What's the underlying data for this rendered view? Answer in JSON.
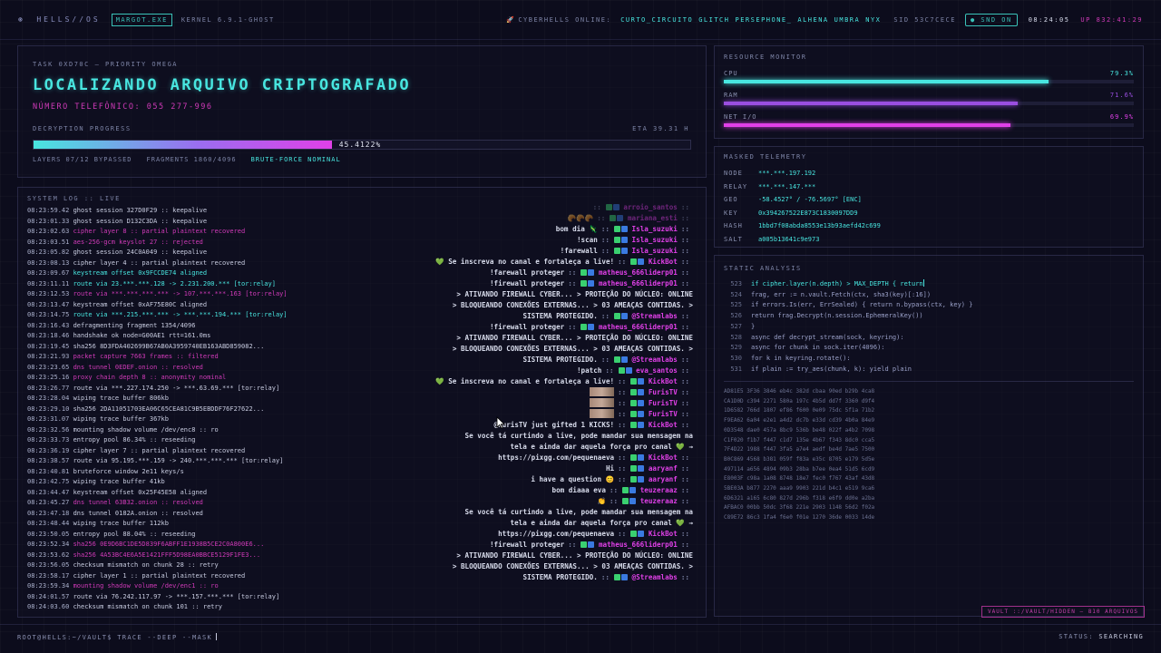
{
  "topbar": {
    "brand": "HELLS//OS",
    "exe": "MARGOT.EXE",
    "kernel": "KERNEL 6.9.1-GHOST",
    "online_label": "CYBERHELLS ONLINE:",
    "users": [
      "CURTO_CIRCUITO",
      "GLITCH",
      "PERSEPHONE_",
      "ALHENA",
      "UMBRA",
      "NYX"
    ],
    "sid": "SID 53C7CECE",
    "snd": "SND ON",
    "clock": "08:24:05",
    "uptime": "UP 832:41:29"
  },
  "task": {
    "label": "TASK 0XD70C — PRIORITY OMEGA",
    "headline": "LOCALIZANDO ARQUIVO CRIPTOGRAFADO",
    "phone": "NÚMERO TELEFÔNICO: 055 277-996",
    "progress_label": "DECRYPTION PROGRESS",
    "eta": "ETA 39.31 H",
    "progress_value": 45.4122,
    "progress_text": "45.4122%",
    "layers": "LAYERS 07/12 BYPASSED",
    "fragments": "FRAGMENTS 1860/4096",
    "mode": "BRUTE-FORCE NOMINAL"
  },
  "log": {
    "title": "SYSTEM LOG :: LIVE",
    "entries": [
      {
        "t": "08:23:59.42",
        "m": "ghost session 327D0F29 :: keepalive",
        "c": "plain"
      },
      {
        "t": "08:23:01.33",
        "m": "ghost session D132C3DA :: keepalive",
        "c": "plain"
      },
      {
        "t": "08:23:02.63",
        "m": "cipher layer 8 :: partial plaintext recovered",
        "c": "mag"
      },
      {
        "t": "08:23:03.51",
        "m": "aes-256-gcm keyslot 27 :: rejected",
        "c": "mag"
      },
      {
        "t": "08:23:05.82",
        "m": "ghost session 24C0A049 :: keepalive",
        "c": "plain"
      },
      {
        "t": "08:23:08.13",
        "m": "cipher layer 4 :: partial plaintext recovered",
        "c": "plain"
      },
      {
        "t": "08:23:09.67",
        "m": "keystream offset 0x9FCCDE74 aligned",
        "c": "cyan"
      },
      {
        "t": "08:23:11.11",
        "m": "route via 23.***.***.128 -> 2.231.200.*** [tor:relay]",
        "c": "cyan"
      },
      {
        "t": "08:23:12.53",
        "m": "route via ***.***.***.*** -> 107.***.***.163 [tor:relay]",
        "c": "mag"
      },
      {
        "t": "08:23:13.47",
        "m": "keystream offset 0xAF75E80C aligned",
        "c": "plain"
      },
      {
        "t": "08:23:14.75",
        "m": "route via ***.215.***.*** -> ***.***.194.*** [tor:relay]",
        "c": "cyan"
      },
      {
        "t": "08:23:16.43",
        "m": "defragmenting fragment 1354/4096",
        "c": "plain"
      },
      {
        "t": "08:23:18.46",
        "m": "handshake ok node=G00AE1 rtt=161.0ms",
        "c": "plain"
      },
      {
        "t": "08:23:19.45",
        "m": "sha256 8D3FDA402699B67AB0A3959740EB163ABD859082...",
        "c": "plain"
      },
      {
        "t": "08:23:21.93",
        "m": "packet capture 7663 frames :: filtered",
        "c": "mag"
      },
      {
        "t": "08:23:23.65",
        "m": "dns tunnel 0EDEF.onion :: resolved",
        "c": "mag"
      },
      {
        "t": "08:23:25.16",
        "m": "proxy chain depth 8 :: anonymity nominal",
        "c": "mag"
      },
      {
        "t": "08:23:26.77",
        "m": "route via ***.227.174.250 -> ***.63.69.*** [tor:relay]",
        "c": "plain"
      },
      {
        "t": "08:23:28.04",
        "m": "wiping trace buffer 806kb",
        "c": "plain"
      },
      {
        "t": "08:23:29.10",
        "m": "sha256 2DA11051703EA06C65CEA81C9B5EBDDF76F27622...",
        "c": "plain"
      },
      {
        "t": "08:23:31.07",
        "m": "wiping trace buffer 367kb",
        "c": "plain"
      },
      {
        "t": "08:23:32.56",
        "m": "mounting shadow volume /dev/enc8 :: ro",
        "c": "plain"
      },
      {
        "t": "08:23:33.73",
        "m": "entropy pool 86.34% :: reseeding",
        "c": "plain"
      },
      {
        "t": "08:23:36.19",
        "m": "cipher layer 7 :: partial plaintext recovered",
        "c": "plain"
      },
      {
        "t": "08:23:38.57",
        "m": "route via 95.195.***.159 -> 240.***.***.*** [tor:relay]",
        "c": "plain"
      },
      {
        "t": "08:23:40.81",
        "m": "bruteforce window 2e11 keys/s",
        "c": "plain"
      },
      {
        "t": "08:23:42.75",
        "m": "wiping trace buffer 41kb",
        "c": "plain"
      },
      {
        "t": "08:23:44.47",
        "m": "keystream offset 0x25F45E58 aligned",
        "c": "plain"
      },
      {
        "t": "08:23:45.27",
        "m": "dns tunnel 63B32.onion :: resolved",
        "c": "mag"
      },
      {
        "t": "08:23:47.18",
        "m": "dns tunnel 0182A.onion :: resolved",
        "c": "plain"
      },
      {
        "t": "08:23:48.44",
        "m": "wiping trace buffer 112kb",
        "c": "plain"
      },
      {
        "t": "08:23:50.05",
        "m": "entropy pool 88.04% :: reseeding",
        "c": "plain"
      },
      {
        "t": "08:23:52.34",
        "m": "sha256 0E9D6BC1DE5D839F6ABFF1E1938B5CE2C0A800E6...",
        "c": "mag"
      },
      {
        "t": "08:23:53.62",
        "m": "sha256 4A53BC4E6A5E1421FFF5D98EA0BBCE5129F1FE3...",
        "c": "mag"
      },
      {
        "t": "08:23:56.05",
        "m": "checksum mismatch on chunk 28 :: retry",
        "c": "plain"
      },
      {
        "t": "08:23:58.17",
        "m": "cipher layer 1 :: partial plaintext recovered",
        "c": "plain"
      },
      {
        "t": "08:23:59.34",
        "m": "mounting shadow volume /dev/enc1 :: ro",
        "c": "mag"
      },
      {
        "t": "08:24:01.57",
        "m": "route via 76.242.117.97 -> ***.157.***.*** [tor:relay]",
        "c": "plain"
      },
      {
        "t": "08:24:03.60",
        "m": "checksum mismatch on chunk 101 :: retry",
        "c": "plain"
      }
    ]
  },
  "chat": [
    {
      "msg": "bom dia 🦎",
      "user": "Isla_suzuki"
    },
    {
      "msg": "!scan",
      "user": "Isla_suzuki"
    },
    {
      "msg": "!farewall",
      "user": "Isla_suzuki"
    },
    {
      "msg": "💚 Se inscreva no canal e fortaleça a live!",
      "user": "KickBot",
      "bot": true
    },
    {
      "msg": "!farewall proteger",
      "user": "matheus_666liderp01"
    },
    {
      "msg": "!firewall proteger",
      "user": "matheus_666liderp01"
    },
    {
      "msg": "> ATIVANDO FIREWALL CYBER... > PROTEÇÃO DO NÚCLEO: ONLINE",
      "user": ""
    },
    {
      "msg": "> BLOQUEANDO CONEXÕES EXTERNAS... > 03 AMEAÇAS CONTIDAS. >",
      "user": ""
    },
    {
      "msg": "SISTEMA PROTEGIDO.",
      "user": "@Streamlabs"
    },
    {
      "msg": "!firewall proteger",
      "user": "matheus_666liderp01"
    },
    {
      "msg": "> ATIVANDO FIREWALL CYBER... > PROTEÇÃO DO NÚCLEO: ONLINE",
      "user": ""
    },
    {
      "msg": "> BLOQUEANDO CONEXÕES EXTERNAS... > 03 AMEAÇAS CONTIDAS. >",
      "user": ""
    },
    {
      "msg": "SISTEMA PROTEGIDO.",
      "user": "@Streamlabs"
    },
    {
      "msg": "!patch",
      "user": "eva_santos"
    },
    {
      "msg": "💚 Se inscreva no canal e fortaleça a live!",
      "user": "KickBot",
      "bot": true
    },
    {
      "msg": "",
      "user": "FurisTV",
      "thumb": true
    },
    {
      "msg": "",
      "user": "FurisTV",
      "thumb": true
    },
    {
      "msg": "",
      "user": "FurisTV",
      "thumb": true
    },
    {
      "msg": "@FurisTV just gifted 1 KICKS!",
      "user": "KickBot"
    },
    {
      "msg": "Se você tá curtindo a live, pode mandar sua mensagem na",
      "user": ""
    },
    {
      "msg": "tela e ainda dar aquela força pro canal 💚 →",
      "user": ""
    },
    {
      "msg": "https://pixgg.com/pequenaeva",
      "user": "KickBot"
    },
    {
      "msg": "Hi",
      "user": "aaryanf"
    },
    {
      "msg": "i have a question 😊",
      "user": "aaryanf"
    },
    {
      "msg": "bom diaaa eva",
      "user": "teuzeraaz"
    },
    {
      "msg": "👏",
      "user": "teuzeraaz"
    },
    {
      "msg": "Se você tá curtindo a live, pode mandar sua mensagem na",
      "user": ""
    },
    {
      "msg": "tela e ainda dar aquela força pro canal 💚 →",
      "user": ""
    },
    {
      "msg": "https://pixgg.com/pequenaeva",
      "user": "KickBot"
    },
    {
      "msg": "!firewall proteger",
      "user": "matheus_666liderp01"
    },
    {
      "msg": "> ATIVANDO FIREWALL CYBER... > PROTEÇÃO DO NÚCLEO: ONLINE",
      "user": ""
    },
    {
      "msg": "> BLOQUEANDO CONEXÕES EXTERNAS... > 03 AMEAÇAS CONTIDAS. >",
      "user": ""
    },
    {
      "msg": "SISTEMA PROTEGIDO.",
      "user": "@Streamlabs"
    }
  ],
  "chat_top": [
    {
      "msg": "",
      "user": "arroio_santos"
    },
    {
      "msg": "🥐🥐🥐",
      "user": "mariana_esti"
    }
  ],
  "resources": {
    "title": "RESOURCE MONITOR",
    "items": [
      {
        "label": "CPU",
        "value": 79.3,
        "text": "79.3%",
        "color": "#48e6e0"
      },
      {
        "label": "RAM",
        "value": 71.6,
        "text": "71.6%",
        "color": "#9a4ee0"
      },
      {
        "label": "NET I/O",
        "value": 69.9,
        "text": "69.9%",
        "color": "#e040e8"
      }
    ]
  },
  "telemetry": {
    "title": "MASKED TELEMETRY",
    "rows": [
      {
        "k": "NODE",
        "v": "***.***.197.192"
      },
      {
        "k": "RELAY",
        "v": "***.***.147.***"
      },
      {
        "k": "GEO",
        "v": "-58.4527° / -76.5697° [ENC]"
      },
      {
        "k": "KEY",
        "v": "0x394267522E873C1830097DD9"
      },
      {
        "k": "HASH",
        "v": "1bbd7f08abda8553e13b93aefd42c699"
      },
      {
        "k": "SALT",
        "v": "a005b13641c9e973"
      }
    ]
  },
  "static": {
    "title": "STATIC ANALYSIS",
    "code": [
      {
        "n": "523",
        "s": "if cipher.layer(n.depth) > MAX_DEPTH { return",
        "cur": true
      },
      {
        "n": "524",
        "s": "frag, err := n.vault.Fetch(ctx, sha3(key)[:16])"
      },
      {
        "n": "525",
        "s": "if errors.Is(err, ErrSealed) { return n.bypass(ctx, key) }"
      },
      {
        "n": "526",
        "s": "return frag.Decrypt(n.session.EphemeralKey())"
      },
      {
        "n": "527",
        "s": "}"
      },
      {
        "n": "528",
        "s": "async def decrypt_stream(sock, keyring):"
      },
      {
        "n": "529",
        "s": "async for chunk in sock.iter(4096):"
      },
      {
        "n": "530",
        "s": "for k in keyring.rotate():"
      },
      {
        "n": "531",
        "s": "if plain := try_aes(chunk, k): yield plain"
      }
    ],
    "hex": [
      "AD81E5 3F36 3846 eb4c 382d cbaa 90ed b29b 4ca8",
      "CA1D0D c394 2271 580a 197c 4b5d dd7f 3360 d9f4",
      "1D6582 766d 1807 ef86 f600 0e09 75dc 5f1a 71b2",
      "F9EA62 6a04 e2e1 a4d2 dc7b e33d cd39 4b0a 84e9",
      "0D3548 dae0 457a 8bc9 536b be48 022f a4b2 7098",
      "C1F020 f1b7 f447 c1d7 135e 4b67 f343 8dc0 cca5",
      "7F4D22 1988 f447 3fa5 a7e4 aedf be4d 7ae5 7500",
      "B0C869 4568 b381 059f f83a e35c 8705 e179 5d5e",
      "497114 a656 4894 09b3 28ba b7ee 0ea4 51d5 6cd9",
      "E8003F c98a 1a08 8748 18e7 fec0 f767 43af 43d8",
      "5BE03A b877 2270 aaa9 9903 221d b4c1 e519 9ca6",
      "6D6321 a165 6c80 827d 296b f318 e6f9 dd0e a2ba",
      "AFBAC0 00bb 50dc 3f68 221e 2903 1148 56d2 f02a",
      "C89E72 86c3 1fa4 f6e0 f01e 1270 36de 0033 14de"
    ]
  },
  "vault": "VAULT ::/VAULT/HIDDEN — 810 ARQUIVOS",
  "bottombar": {
    "prompt": "ROOT@HELLS:~/VAULT$ TRACE --DEEP --MASK",
    "status_label": "STATUS:",
    "status_value": "SEARCHING"
  }
}
